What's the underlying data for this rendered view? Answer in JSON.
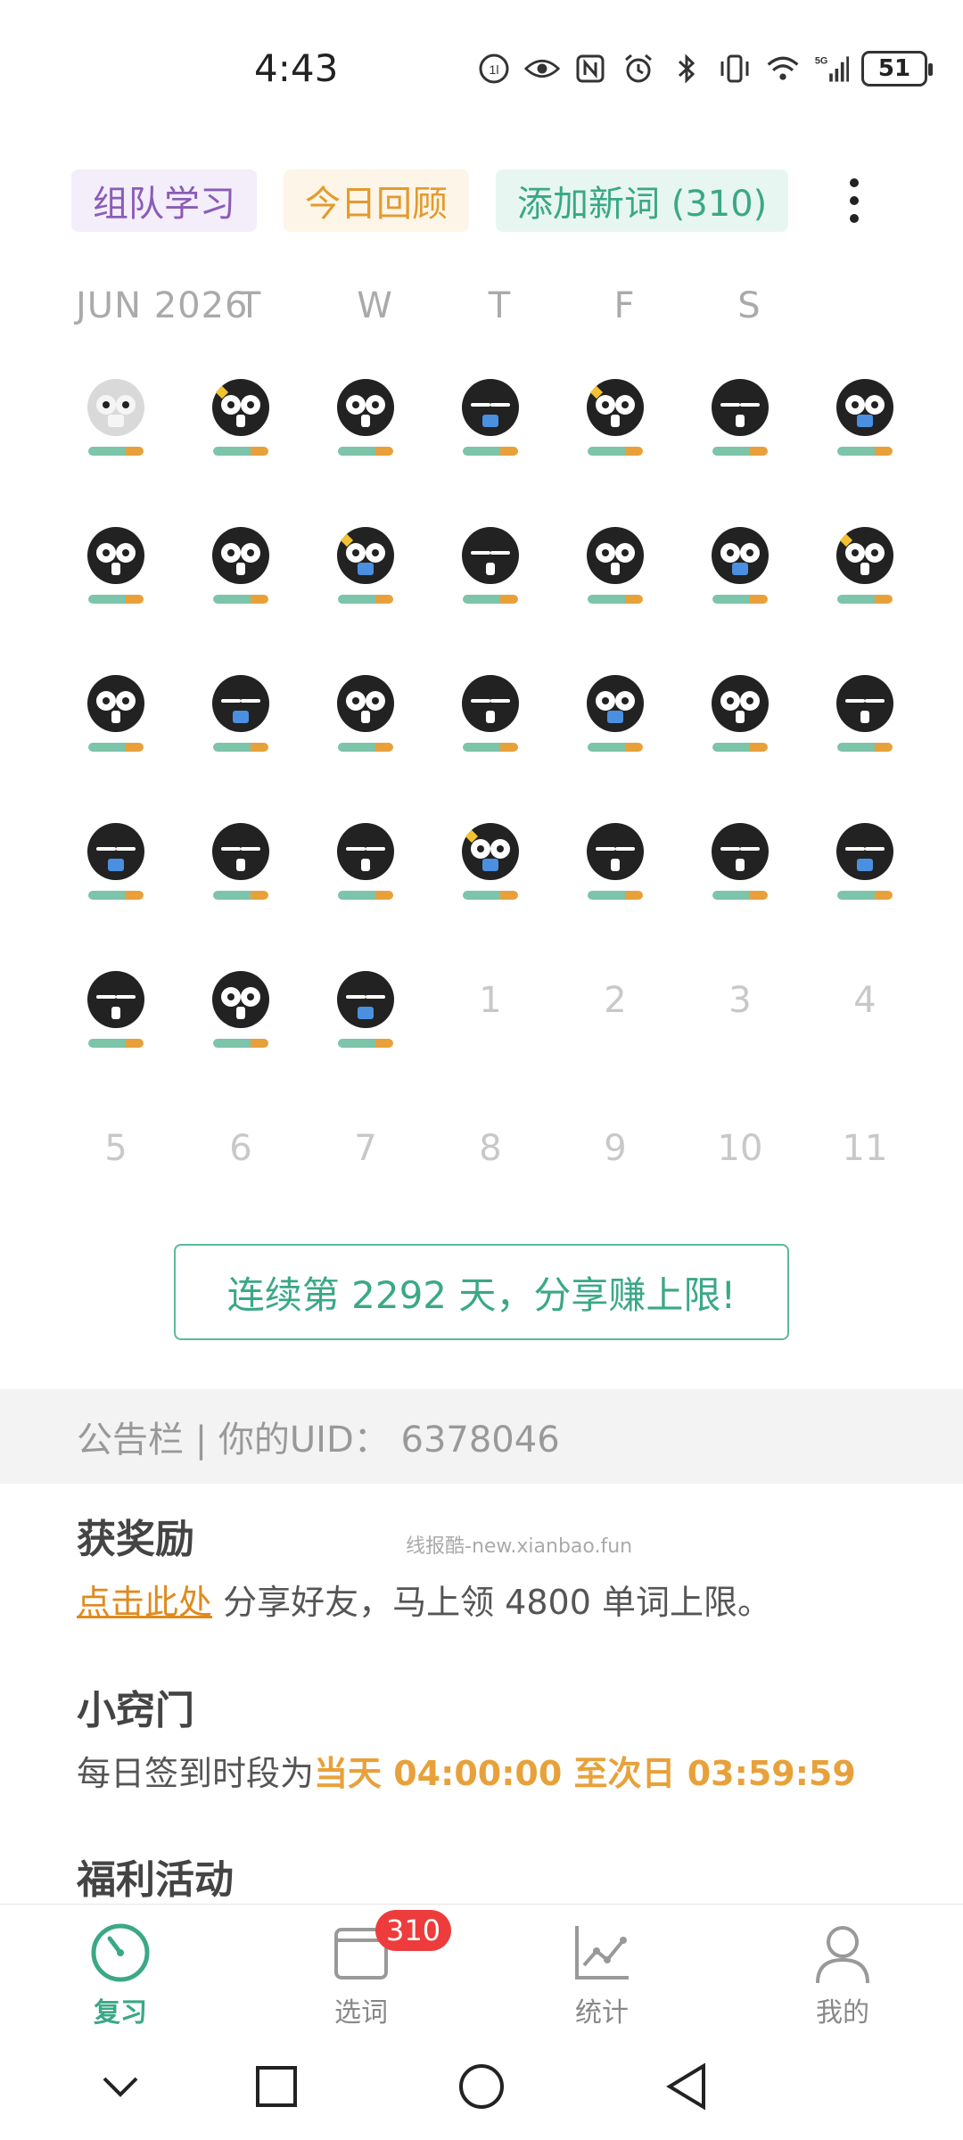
{
  "status_bar": {
    "time": "4:43",
    "battery": "51",
    "icons": [
      "hd-icon",
      "eye-icon",
      "nfc-icon",
      "alarm-icon",
      "bluetooth-icon",
      "vibrate-icon",
      "wifi-icon",
      "signal-5g-icon",
      "battery-icon"
    ]
  },
  "top_actions": {
    "team_study": "组队学习",
    "today_review": "今日回顾",
    "add_words": "添加新词 (310)",
    "more_icon": "more-vertical-icon"
  },
  "calendar": {
    "month_label": "JUN 2026",
    "weekdays": [
      "T",
      "W",
      "T",
      "F",
      "S"
    ],
    "rows": [
      [
        "owl-faded",
        "owl-wink",
        "owl",
        "owl-sleep",
        "owl-wink",
        "owl-sleep",
        "owl"
      ],
      [
        "owl",
        "owl",
        "owl-wink",
        "owl-sleep",
        "owl",
        "owl",
        "owl-wink"
      ],
      [
        "owl",
        "owl-sleep",
        "owl",
        "owl-sleep",
        "owl",
        "owl",
        "owl-sleep"
      ],
      [
        "owl-sleep",
        "owl-sleep",
        "owl-sleep",
        "owl-wink",
        "owl-sleep",
        "owl-sleep",
        "owl-sleep"
      ],
      [
        "owl-sleep",
        "owl",
        "owl-sleep",
        "1",
        "2",
        "3",
        "4"
      ],
      [
        "5",
        "6",
        "7",
        "8",
        "9",
        "10",
        "11"
      ]
    ]
  },
  "streak_button": "连续第 2292 天，分享赚上限!",
  "bulletin": {
    "header": "公告栏 | 你的UID：  6378046",
    "reward_title": "获奖励",
    "reward_link": "点击此处",
    "reward_text": " 分享好友，马上领 4800 单词上限。",
    "tip_title": "小窍门",
    "tip_prefix": "每日签到时段为",
    "tip_highlight": "当天 04:00:00 至次日 03:59:59",
    "welfare_title": "福利活动",
    "watermark": "线报酷-new.xianbao.fun"
  },
  "tabbar": {
    "tabs": [
      {
        "label": "复习",
        "icon": "gauge-icon"
      },
      {
        "label": "选词",
        "icon": "book-icon",
        "badge": "310"
      },
      {
        "label": "统计",
        "icon": "chart-icon"
      },
      {
        "label": "我的",
        "icon": "profile-icon"
      }
    ],
    "active_color": "#3aa886"
  },
  "colors": {
    "accent_green": "#3aa886",
    "accent_orange": "#e8a13a",
    "accent_purple": "#8a5cb8",
    "badge_red": "#ee3b3b"
  }
}
